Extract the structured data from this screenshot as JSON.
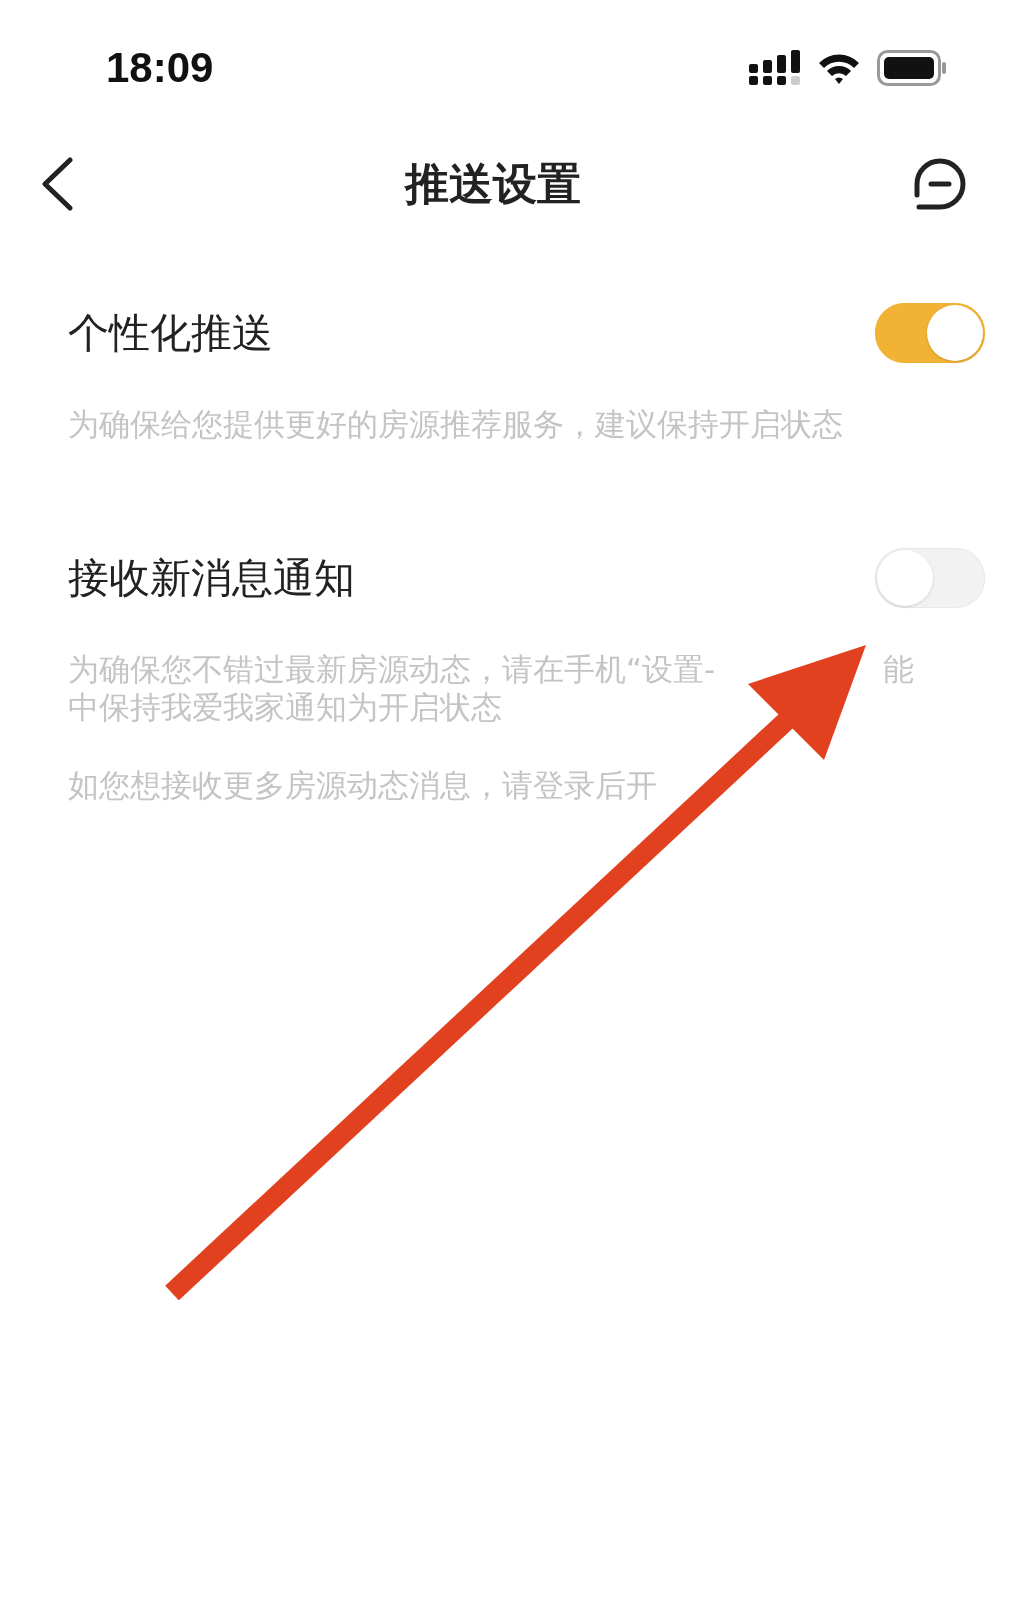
{
  "status_bar": {
    "time": "18:09"
  },
  "nav": {
    "title": "推送设置"
  },
  "settings": [
    {
      "title": "个性化推送",
      "on": true,
      "descriptions": [
        {
          "lines": [
            [
              "为确保给您提供更好的房源推荐服务，建议保持开启状态"
            ]
          ]
        }
      ]
    },
    {
      "title": "接收新消息通知",
      "on": false,
      "descriptions": [
        {
          "lines": [
            [
              "为确保您不错过最新房源动态，请在手机“设置-",
              "能"
            ],
            [
              "中保持我爱我家通知为开启状态"
            ]
          ]
        },
        {
          "lines": [
            [
              "如您想接收更多房源动态消息，请登录后开"
            ]
          ]
        }
      ]
    }
  ]
}
